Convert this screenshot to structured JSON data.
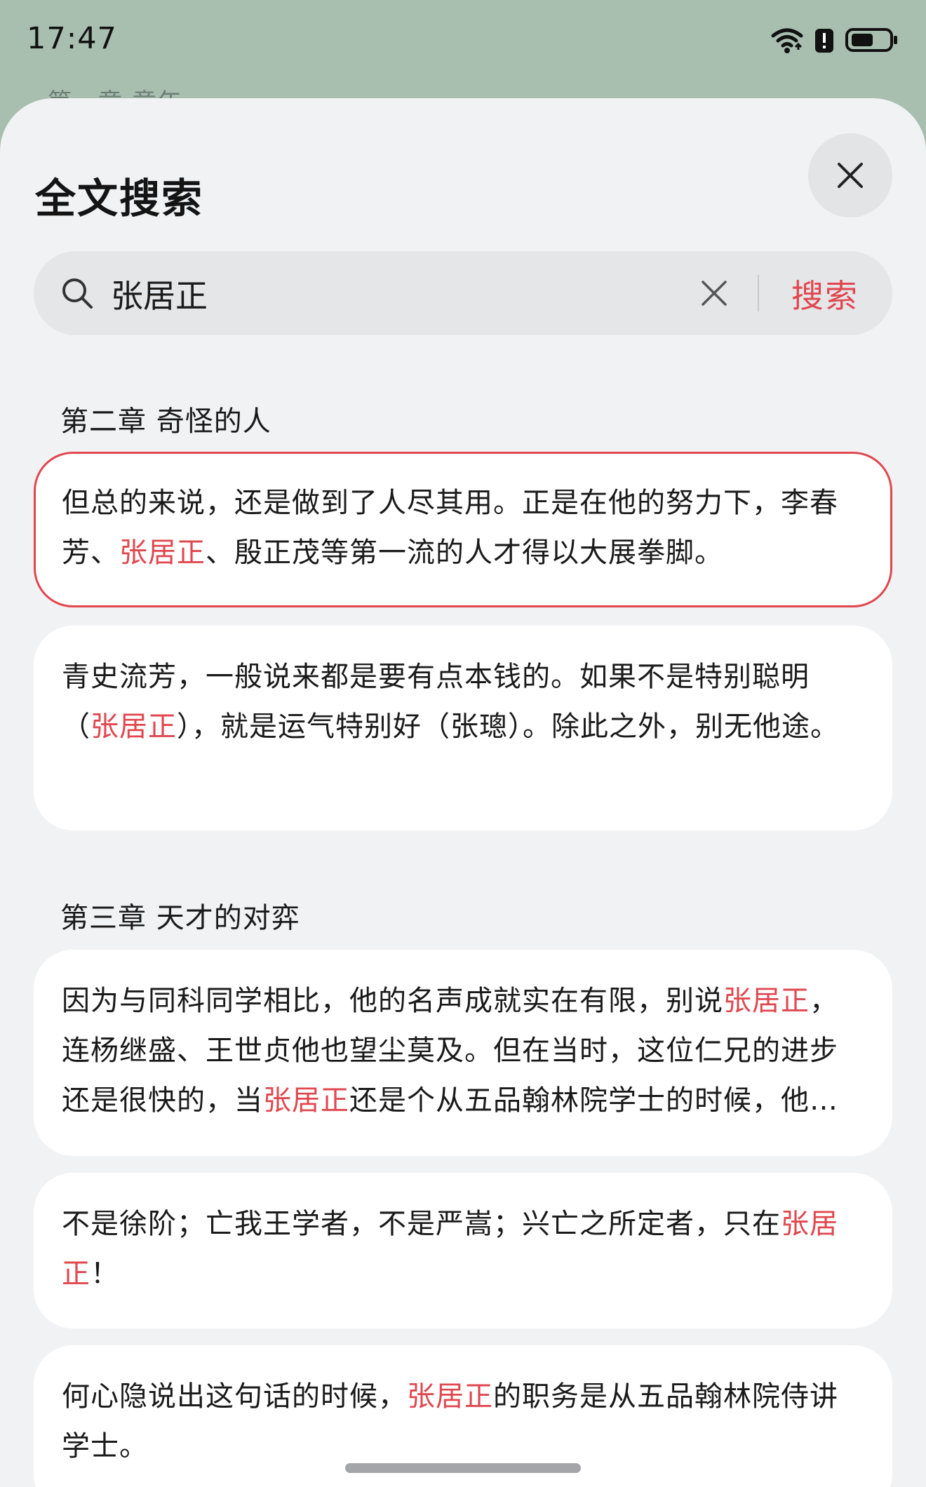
{
  "status_bar": {
    "time": "17:47",
    "icons": [
      "wifi-icon",
      "alert-icon",
      "battery-icon"
    ]
  },
  "background": {
    "chapter_text": "第一章 童年"
  },
  "sheet": {
    "title": "全文搜索",
    "close_icon": "close-icon"
  },
  "search": {
    "value": "张居正",
    "placeholder": "",
    "button_label": "搜索",
    "search_icon": "search-icon",
    "clear_icon": "clear-icon"
  },
  "colors": {
    "accent": "#e0474f",
    "sheet_bg": "#f1f2f4",
    "card_bg": "#ffffff",
    "app_bg": "#a8bfb0"
  },
  "chapters": [
    {
      "title": "第二章 奇怪的人",
      "results": [
        {
          "selected": true,
          "segments": [
            {
              "text": "但总的来说，还是做到了人尽其用。正是在他的努力下，李春芳、",
              "hl": false
            },
            {
              "text": "张居正",
              "hl": true
            },
            {
              "text": "、殷正茂等第一流的人才得以大展拳脚。",
              "hl": false
            }
          ]
        },
        {
          "selected": false,
          "segments": [
            {
              "text": "青史流芳，一般说来都是要有点本钱的。如果不是特别聪明（",
              "hl": false
            },
            {
              "text": "张居正",
              "hl": true
            },
            {
              "text": "），就是运气特别好（张璁）。除此之外，别无他途。",
              "hl": false
            }
          ]
        }
      ]
    },
    {
      "title": "第三章 天才的对弈",
      "results": [
        {
          "selected": false,
          "segments": [
            {
              "text": "因为与同科同学相比，他的名声成就实在有限，别说",
              "hl": false
            },
            {
              "text": "张居正",
              "hl": true
            },
            {
              "text": "，连杨继盛、王世贞他也望尘莫及。但在当时，这位仁兄的进步还是很快的，当",
              "hl": false
            },
            {
              "text": "张居正",
              "hl": true
            },
            {
              "text": "还是个从五品翰林院学士的时候，他…",
              "hl": false
            }
          ]
        },
        {
          "selected": false,
          "segments": [
            {
              "text": "不是徐阶；亡我王学者，不是严嵩；兴亡之所定者，只在",
              "hl": false
            },
            {
              "text": "张居正",
              "hl": true
            },
            {
              "text": "！",
              "hl": false
            }
          ]
        },
        {
          "selected": false,
          "segments": [
            {
              "text": "何心隐说出这句话的时候，",
              "hl": false
            },
            {
              "text": "张居正",
              "hl": true
            },
            {
              "text": "的职务是从五品翰林院侍讲学士。",
              "hl": false
            }
          ]
        }
      ]
    }
  ]
}
